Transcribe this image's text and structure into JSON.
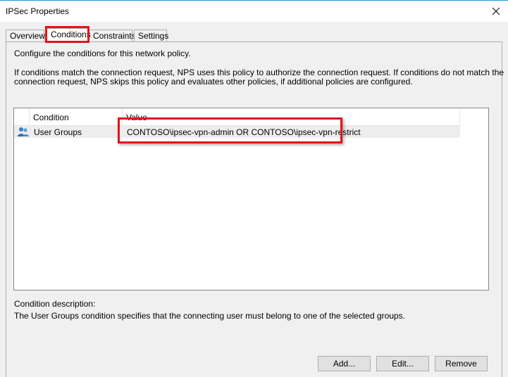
{
  "window": {
    "title": "IPSec Properties",
    "close_icon": "close-icon"
  },
  "tabs": [
    {
      "label": "Overview",
      "selected": false
    },
    {
      "label": "Conditions",
      "selected": true
    },
    {
      "label": "Constraints",
      "selected": false
    },
    {
      "label": "Settings",
      "selected": false
    }
  ],
  "panel": {
    "intro": "Configure the conditions for this network policy.",
    "description_line1": "If conditions match the connection request, NPS uses this policy to authorize the connection request. If conditions do not match the",
    "description_line2": "connection request, NPS skips this policy and evaluates other policies, if additional policies are configured."
  },
  "conditions_list": {
    "columns": [
      "Condition",
      "Value"
    ],
    "rows": [
      {
        "icon": "user-group-icon",
        "condition": "User Groups",
        "value": "CONTOSO\\ipsec-vpn-admin OR CONTOSO\\ipsec-vpn-restrict"
      }
    ]
  },
  "condition_description": {
    "label": "Condition description:",
    "text": "The User Groups condition specifies that the connecting user must belong to one of the selected groups."
  },
  "buttons": {
    "add": "Add...",
    "edit": "Edit...",
    "remove": "Remove"
  },
  "colors": {
    "highlight": "#e3141a",
    "titlebar_border": "#2b8fd8"
  }
}
